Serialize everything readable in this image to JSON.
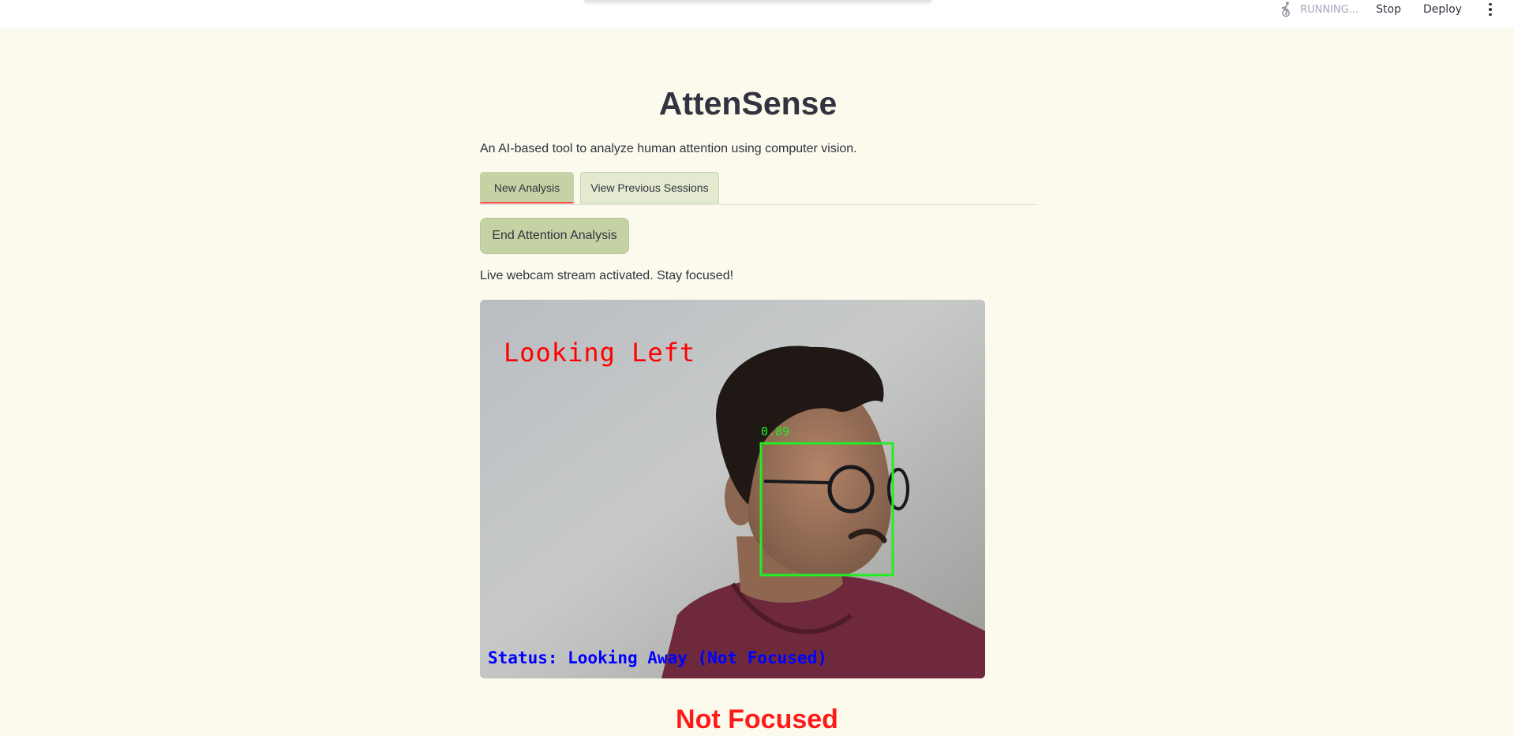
{
  "topbar": {
    "running_label": "RUNNING...",
    "stop_label": "Stop",
    "deploy_label": "Deploy",
    "icons": [
      "running-figure-icon",
      "kebab-menu-icon"
    ]
  },
  "app": {
    "title": "AttenSense",
    "subtitle": "An AI-based tool to analyze human attention using computer vision."
  },
  "tabs": [
    {
      "label": "New Analysis",
      "active": true
    },
    {
      "label": "View Previous Sessions",
      "active": false
    }
  ],
  "end_button_label": "End Attention Analysis",
  "stream_message": "Live webcam stream activated. Stay focused!",
  "webcam": {
    "direction_label": "Looking Left",
    "confidence": "0.89",
    "status_overlay": "Status: Looking Away (Not Focused)",
    "colors": {
      "direction": "#ff0000",
      "box": "#22ee22",
      "status": "#0000ff"
    }
  },
  "focus_status": "Not Focused",
  "colors": {
    "background": "#fcfaec",
    "accent_green": "#c5d3a4",
    "alert_red": "#ff1a1a"
  }
}
